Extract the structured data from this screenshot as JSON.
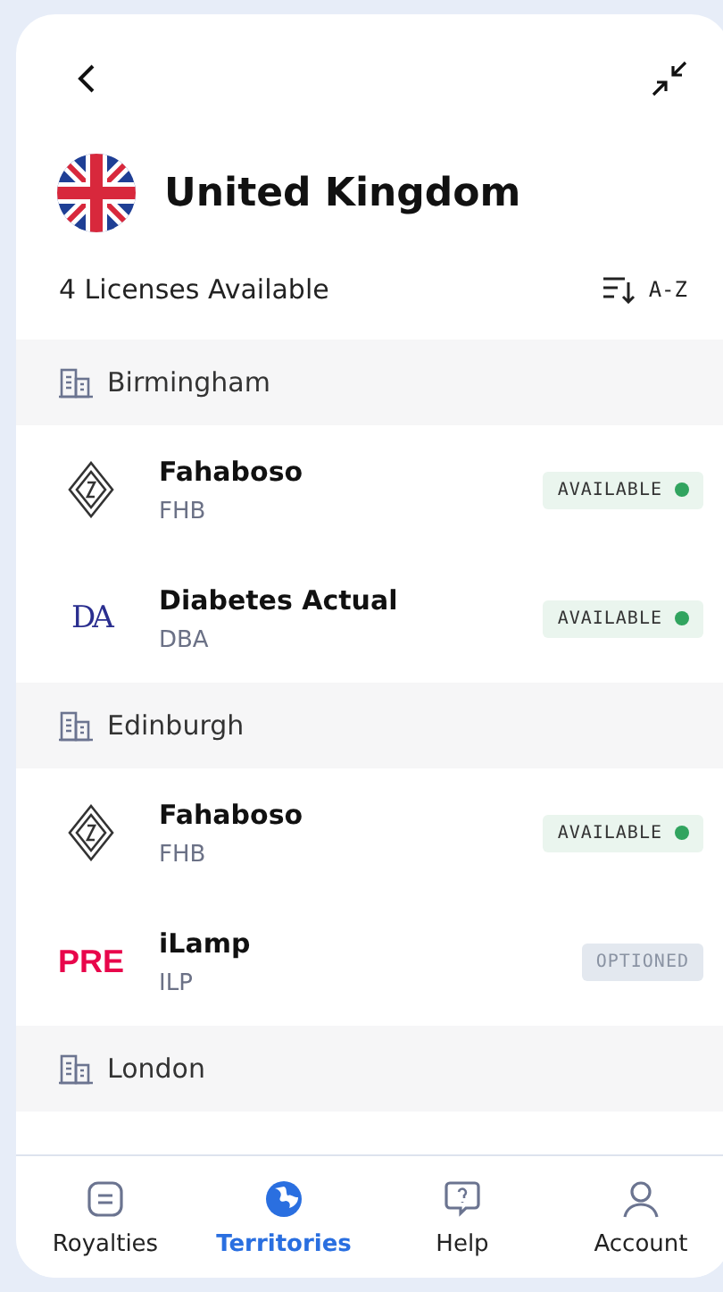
{
  "header": {
    "title": "United Kingdom",
    "licenses": "4 Licenses Available",
    "sort": "A-Z"
  },
  "groups": [
    {
      "city": "Birmingham",
      "items": [
        {
          "name": "Fahaboso",
          "code": "FHB",
          "logo": {
            "kind": "diamond"
          },
          "status": {
            "kind": "available",
            "label": "AVAILABLE"
          }
        },
        {
          "name": "Diabetes Actual",
          "code": "DBA",
          "logo": {
            "kind": "serif-wordmark",
            "text": "DA"
          },
          "status": {
            "kind": "available",
            "label": "AVAILABLE"
          }
        }
      ]
    },
    {
      "city": "Edinburgh",
      "items": [
        {
          "name": "Fahaboso",
          "code": "FHB",
          "logo": {
            "kind": "diamond"
          },
          "status": {
            "kind": "available",
            "label": "AVAILABLE"
          }
        },
        {
          "name": "iLamp",
          "code": "ILP",
          "logo": {
            "kind": "bold-wordmark",
            "text": "PRE"
          },
          "status": {
            "kind": "optioned",
            "label": "OPTIONED"
          }
        }
      ]
    },
    {
      "city": "London"
    }
  ],
  "nav": [
    {
      "label": "Royalties",
      "selected": false
    },
    {
      "label": "Territories",
      "selected": true
    },
    {
      "label": "Help",
      "selected": false
    },
    {
      "label": "Account",
      "selected": false
    }
  ]
}
